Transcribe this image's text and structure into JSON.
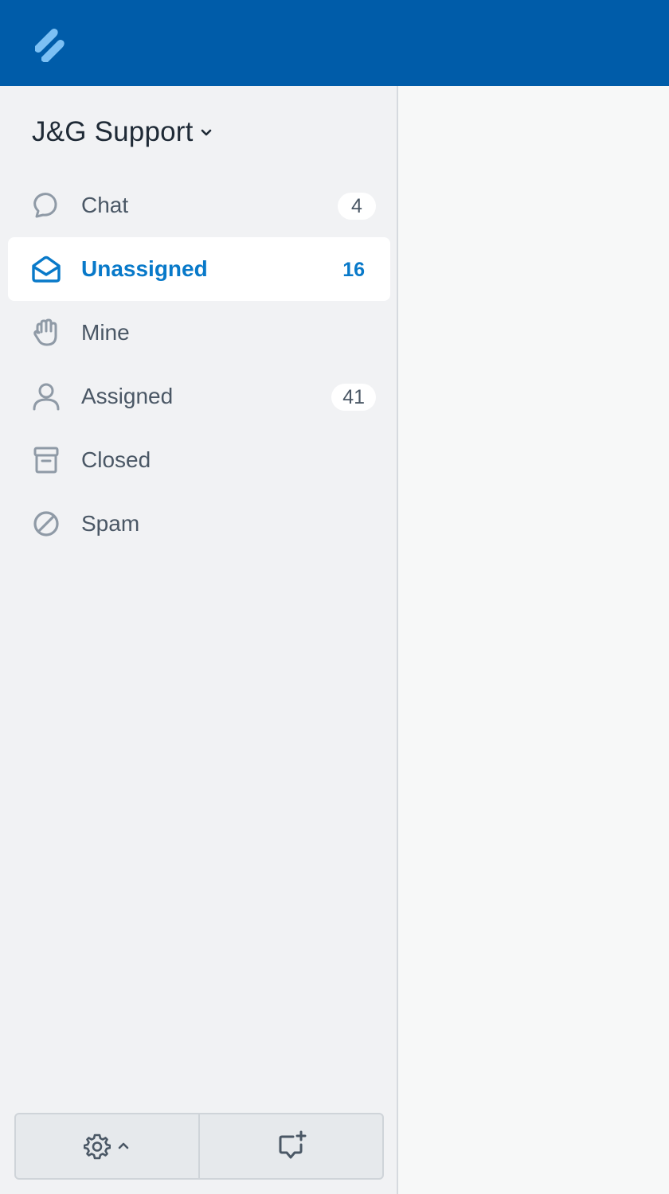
{
  "app": {
    "logo_icon": "helpscout-logo-icon",
    "brand_color": "#005ca9"
  },
  "sidebar": {
    "mailbox_name": "J&G Support",
    "mailbox_chevron_icon": "chevron-down-icon",
    "items": [
      {
        "id": "chat",
        "label": "Chat",
        "count": "4",
        "icon": "chat-bubble-icon",
        "active": false
      },
      {
        "id": "unassigned",
        "label": "Unassigned",
        "count": "16",
        "icon": "open-envelope-icon",
        "active": true
      },
      {
        "id": "mine",
        "label": "Mine",
        "count": "",
        "icon": "raised-hand-icon",
        "active": false
      },
      {
        "id": "assigned",
        "label": "Assigned",
        "count": "41",
        "icon": "person-icon",
        "active": false
      },
      {
        "id": "closed",
        "label": "Closed",
        "count": "",
        "icon": "archive-box-icon",
        "active": false
      },
      {
        "id": "spam",
        "label": "Spam",
        "count": "",
        "icon": "blocked-circle-icon",
        "active": false
      }
    ],
    "footer": {
      "settings_icon": "gear-icon",
      "settings_chevron_icon": "chevron-up-icon",
      "new_conversation_icon": "new-chat-plus-icon"
    }
  },
  "colors": {
    "active_accent": "#0879c9",
    "icon_gray": "#8f9aa6",
    "text_gray": "#4a5765"
  }
}
